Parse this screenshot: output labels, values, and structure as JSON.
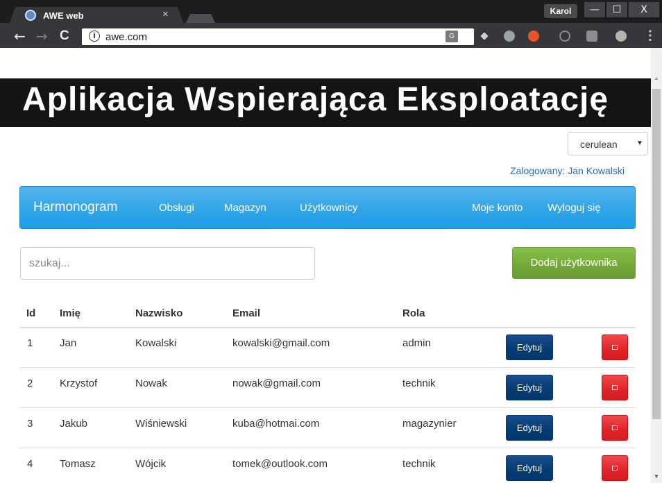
{
  "browser": {
    "tab_title": "AWE web",
    "tab_close": "×",
    "profile_name": "Karol",
    "window_minimize": "—",
    "window_maximize": "☐",
    "window_close": "X",
    "url": "awe.com",
    "back_glyph": "←",
    "forward_glyph": "→",
    "reload_glyph": "C",
    "info_glyph": "i",
    "menu_glyph": "⋮",
    "extensions": [
      "translate-icon",
      "tag-icon",
      "cloud-icon",
      "red-extension-icon",
      "reload-extension-icon",
      "shield-icon",
      "skype-icon"
    ]
  },
  "app": {
    "title": "Aplikacja Wspierająca Eksploatację",
    "theme_select": {
      "value": "cerulean",
      "caret": "▼"
    },
    "logged_in": "Zalogowany: Jan Kowalski",
    "navbar": {
      "brand": "Harmonogram",
      "links": [
        "Obsługi",
        "Magazyn",
        "Użytkownicy"
      ],
      "right_links": [
        "Moje konto",
        "Wyloguj się"
      ]
    },
    "search": {
      "placeholder": "szukaj...",
      "value": ""
    },
    "add_button": "Dodaj użytkownika",
    "table": {
      "headers": [
        "Id",
        "Imię",
        "Nazwisko",
        "Email",
        "Rola"
      ],
      "edit_label": "Edytuj",
      "rows": [
        {
          "id": "1",
          "first": "Jan",
          "last": "Kowalski",
          "email": "kowalski@gmail.com",
          "role": "admin"
        },
        {
          "id": "2",
          "first": "Krzystof",
          "last": "Nowak",
          "email": "nowak@gmail.com",
          "role": "technik"
        },
        {
          "id": "3",
          "first": "Jakub",
          "last": "Wiśniewski",
          "email": "kuba@hotmai.com",
          "role": "magazynier"
        },
        {
          "id": "4",
          "first": "Tomasz",
          "last": "Wójcik",
          "email": "tomek@outlook.com",
          "role": "technik"
        }
      ]
    }
  },
  "colors": {
    "navbar": "#2fa4e7",
    "header_bg": "#141414",
    "add_button": "#73a839",
    "edit_button": "#033c73",
    "delete_button": "#e12328",
    "logged_in_text": "#2a6ab8"
  }
}
